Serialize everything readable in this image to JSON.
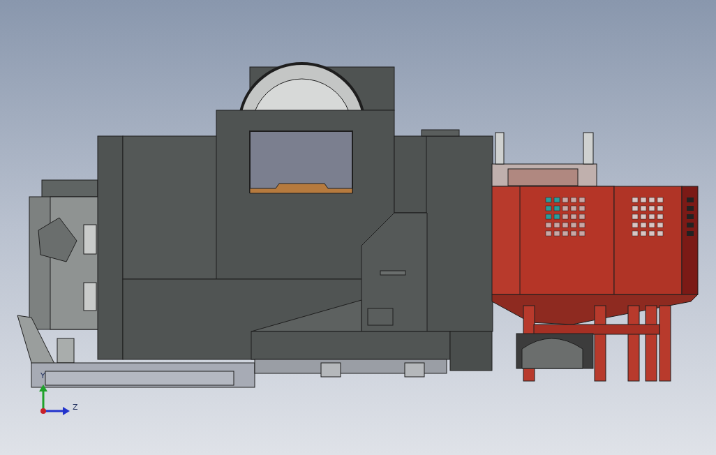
{
  "viewport": {
    "triad": {
      "axes": [
        {
          "kind": "vertical",
          "label": "Y"
        },
        {
          "kind": "horizontal",
          "label": "Z"
        }
      ]
    }
  }
}
